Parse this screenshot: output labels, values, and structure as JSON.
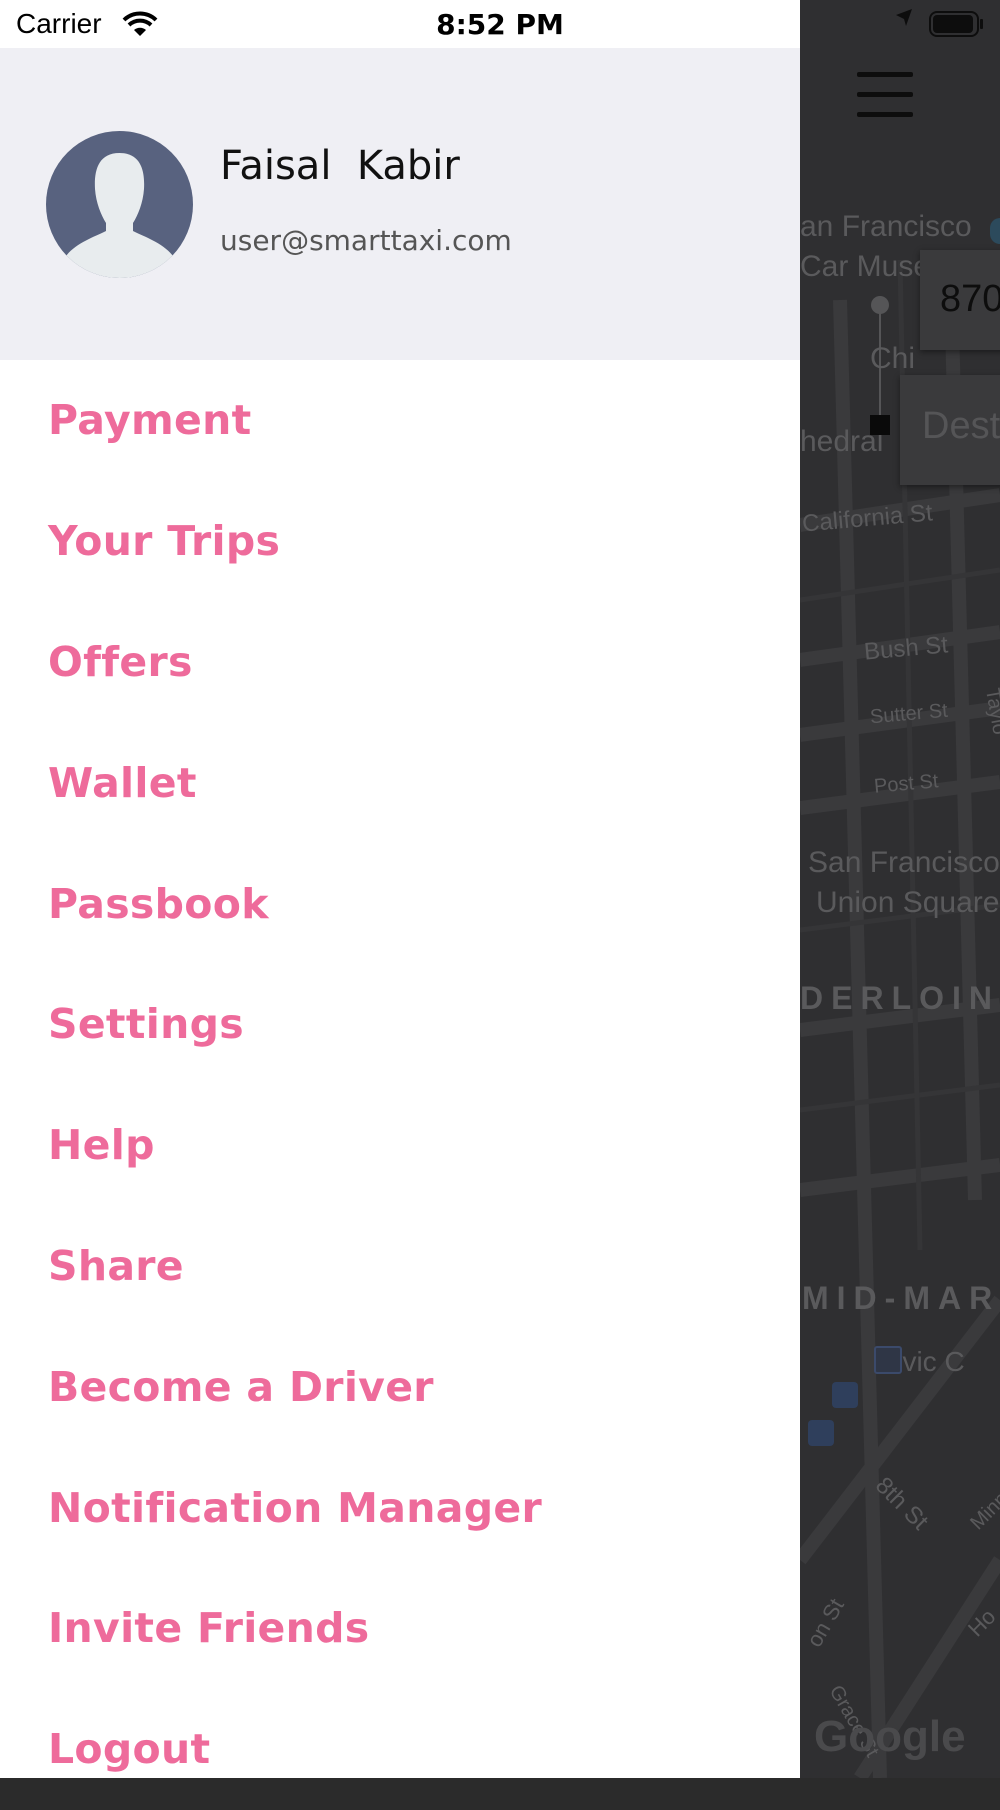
{
  "status_bar": {
    "carrier": "Carrier",
    "time": "8:52 PM",
    "icons": [
      "wifi-icon",
      "location-arrow-icon",
      "battery-icon"
    ]
  },
  "profile": {
    "name": "Faisal  Kabir",
    "email": "user@smarttaxi.com",
    "avatar_icon": "person-silhouette-icon"
  },
  "menu": {
    "items": [
      {
        "label": "Payment"
      },
      {
        "label": "Your Trips"
      },
      {
        "label": "Offers"
      },
      {
        "label": "Wallet"
      },
      {
        "label": "Passbook"
      },
      {
        "label": "Settings"
      },
      {
        "label": "Help"
      },
      {
        "label": "Share"
      },
      {
        "label": "Become a Driver"
      },
      {
        "label": "Notification Manager"
      },
      {
        "label": "Invite Friends"
      },
      {
        "label": "Logout"
      }
    ]
  },
  "map": {
    "labels": {
      "sf_car_museum_1": "an Francisco",
      "sf_car_museum_2": "Car Muse",
      "chinatown": "Chi",
      "cathedral": "hedral",
      "california_st": "California St",
      "bush_st": "Bush St",
      "sutter_st": "Sutter St",
      "taylor": "Taylo",
      "post_st": "Post St",
      "union_square_1": "San Francisco",
      "union_square_2": "Union Square",
      "tenderloin": "DERLOIN",
      "mid_market": "MID-MAR",
      "civic_center": "Civic C",
      "eighth_st": "8th St",
      "minna": "Minn",
      "howard": "Ho",
      "grace": "Grace St",
      "jessie": "on St",
      "google": "Google"
    },
    "pickup_text": "870",
    "destination_placeholder": "Dest"
  },
  "colors": {
    "accent": "#ee6b9b",
    "profile_bg": "#efeff4",
    "avatar_bg": "#58627f",
    "map_bg": "#2f2f31"
  }
}
